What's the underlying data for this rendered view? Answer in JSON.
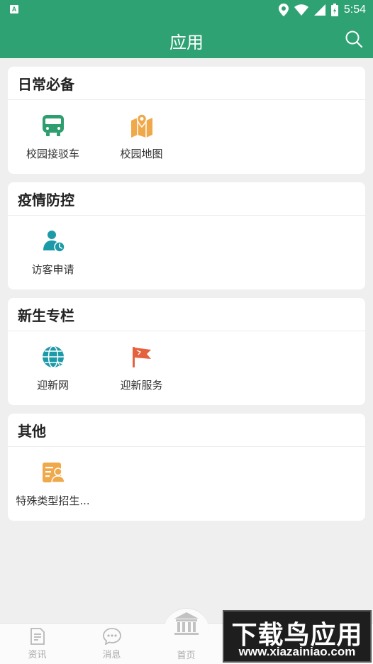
{
  "status_bar": {
    "time": "5:54",
    "app_badge": "A"
  },
  "app_bar": {
    "title": "应用"
  },
  "sections": [
    {
      "title": "日常必备",
      "items": [
        {
          "label": "校园接驳车",
          "icon": "bus-icon"
        },
        {
          "label": "校园地图",
          "icon": "map-icon"
        }
      ]
    },
    {
      "title": "疫情防控",
      "items": [
        {
          "label": "访客申请",
          "icon": "visitor-icon"
        }
      ]
    },
    {
      "title": "新生专栏",
      "items": [
        {
          "label": "迎新网",
          "icon": "globe-icon"
        },
        {
          "label": "迎新服务",
          "icon": "flag-icon"
        }
      ]
    },
    {
      "title": "其他",
      "items": [
        {
          "label": "特殊类型招生...",
          "icon": "id-card-icon"
        }
      ]
    }
  ],
  "bottom_nav": [
    {
      "label": "资讯",
      "icon": "news-icon"
    },
    {
      "label": "消息",
      "icon": "message-icon"
    },
    {
      "label": "首页",
      "icon": "home-building-icon"
    }
  ],
  "watermark": {
    "title": "下载鸟应用",
    "url": "www.xiazainiao.com"
  },
  "colors": {
    "primary": "#2fa273",
    "icon_green": "#2e9e6f",
    "icon_orange": "#f0a94a",
    "icon_teal": "#1d9aa8",
    "icon_red": "#e5623e"
  }
}
